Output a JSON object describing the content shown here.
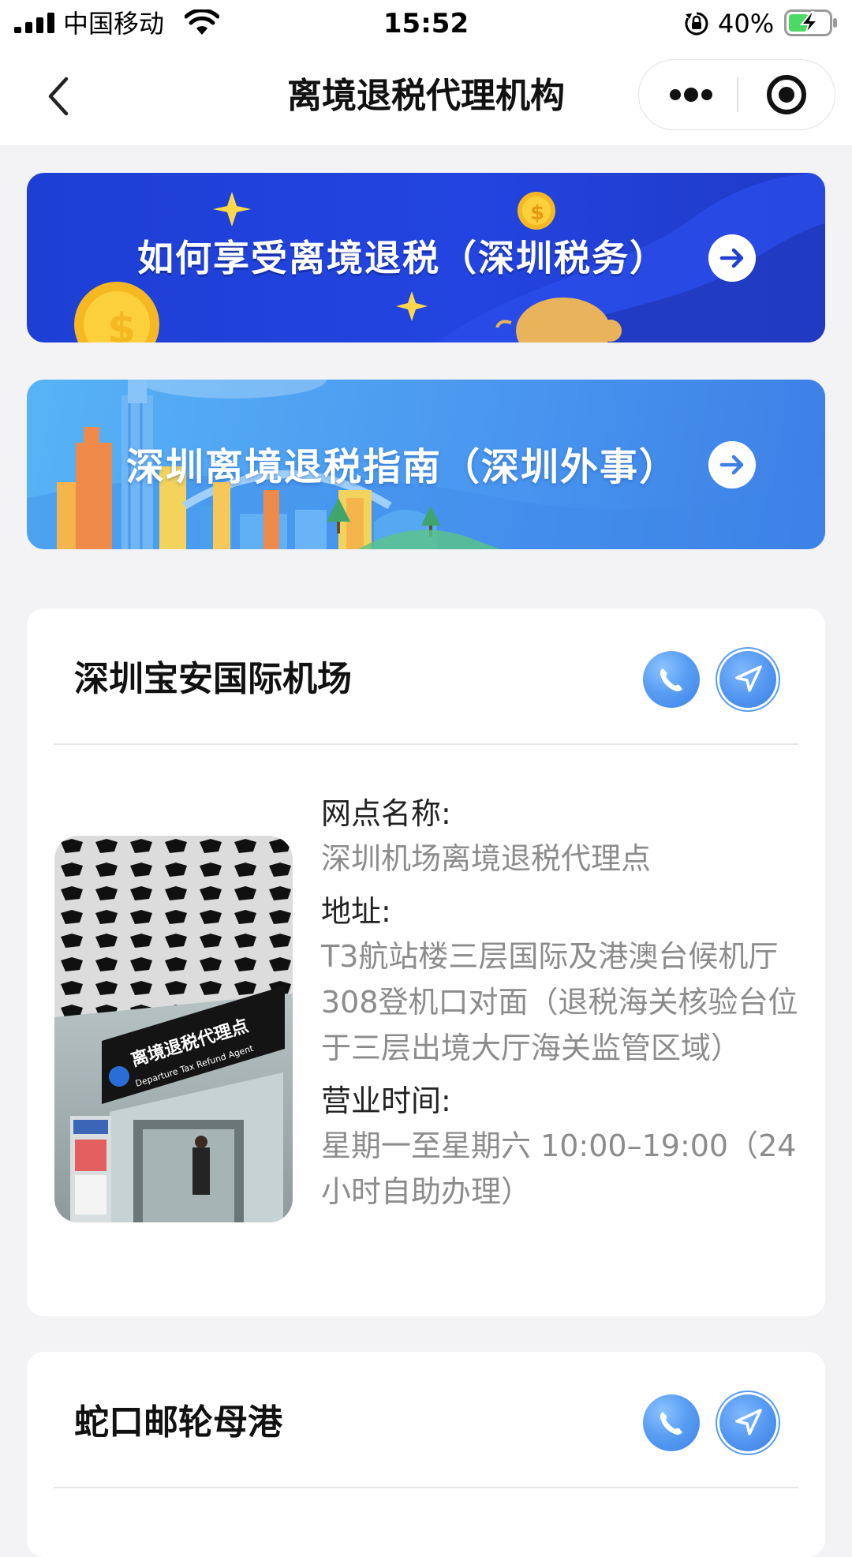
{
  "status_bar": {
    "carrier": "中国移动",
    "time": "15:52",
    "battery_percent": "40%"
  },
  "nav": {
    "title": "离境退税代理机构"
  },
  "banners": [
    {
      "text": "如何享受离境退税（深圳税务）"
    },
    {
      "text": "深圳离境退税指南（深圳外事）"
    }
  ],
  "cards": [
    {
      "title": "深圳宝安国际机场",
      "photo_sign": {
        "cn": "离境退税代理点",
        "en": "Departure Tax Refund Agent"
      },
      "fields": [
        {
          "label": "网点名称:",
          "value": "深圳机场离境退税代理点"
        },
        {
          "label": "地址:",
          "value": "T3航站楼三层国际及港澳台候机厅308登机口对面（退税海关核验台位于三层出境大厅海关监管区域）"
        },
        {
          "label": "营业时间:",
          "value": "星期一至星期六 10:00–19:00（24小时自助办理）"
        }
      ]
    },
    {
      "title": "蛇口邮轮母港"
    }
  ]
}
